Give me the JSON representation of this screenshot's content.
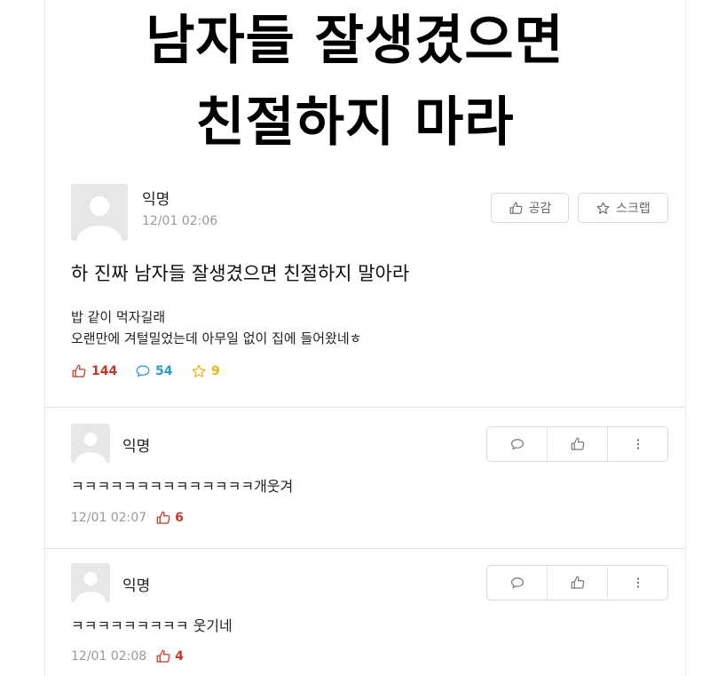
{
  "headline": {
    "line1": "남자들 잘생겼으면",
    "line2": "친절하지 마라"
  },
  "post": {
    "author": "익명",
    "time": "12/01 02:06",
    "empathy_label": "공감",
    "scrap_label": "스크랩",
    "title": "하 진짜 남자들 잘생겼으면 친절하지 말아라",
    "body_line1": "밥 같이 먹자길래",
    "body_line2": "오랜만에 겨털밀었는데 아무일 없이 집에 들어왔네ㅎ",
    "likes": "144",
    "comments": "54",
    "scraps": "9"
  },
  "comments": [
    {
      "author": "익명",
      "text": "ㅋㅋㅋㅋㅋㅋㅋㅋㅋㅋㅋㅋㅋㅋ개웃겨",
      "time": "12/01 02:07",
      "likes": "6"
    },
    {
      "author": "익명",
      "text": "ㅋㅋㅋㅋㅋㅋㅋㅋㅋ 웃기네",
      "time": "12/01 02:08",
      "likes": "4"
    }
  ],
  "colors": {
    "like": "#c0392b",
    "comment": "#2a9cc8",
    "scrap": "#e7b416"
  }
}
